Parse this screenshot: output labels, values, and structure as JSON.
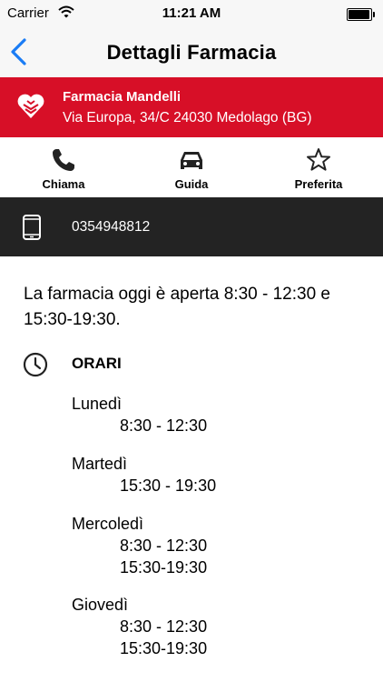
{
  "status_bar": {
    "carrier": "Carrier",
    "time": "11:21 AM",
    "battery_level": 0.95
  },
  "nav": {
    "title": "Dettagli Farmacia"
  },
  "pharmacy": {
    "name": "Farmacia Mandelli",
    "address": "Via Europa, 34/C 24030 Medolago (BG)",
    "brand_color": "#d70f27"
  },
  "actions": {
    "call": "Chiama",
    "drive": "Guida",
    "favorite": "Preferita"
  },
  "phone": {
    "number": "0354948812"
  },
  "today": {
    "text": "La farmacia oggi è aperta 8:30 - 12:30 e 15:30-19:30."
  },
  "schedule": {
    "title": "ORARI",
    "days": [
      {
        "day": "Lunedì",
        "hours": [
          "8:30 - 12:30"
        ]
      },
      {
        "day": "Martedì",
        "hours": [
          "15:30 - 19:30"
        ]
      },
      {
        "day": "Mercoledì",
        "hours": [
          "8:30 - 12:30",
          "15:30-19:30"
        ]
      },
      {
        "day": "Giovedì",
        "hours": [
          "8:30 - 12:30",
          "15:30-19:30"
        ]
      }
    ]
  }
}
